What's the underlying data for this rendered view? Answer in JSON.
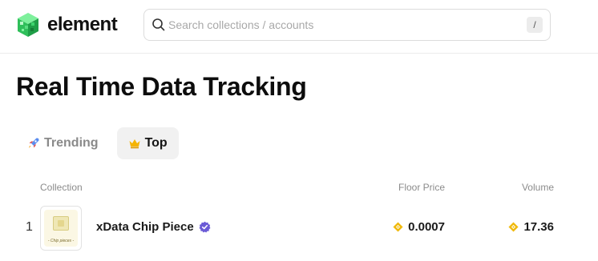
{
  "brand": {
    "name": "element"
  },
  "search": {
    "placeholder": "Search collections / accounts",
    "value": "",
    "shortcut": "/"
  },
  "page": {
    "title": "Real Time Data Tracking"
  },
  "tabs": [
    {
      "label": "Trending",
      "icon": "rocket-icon",
      "active": false
    },
    {
      "label": "Top",
      "icon": "crown-icon",
      "active": true
    }
  ],
  "table": {
    "columns": {
      "collection": "Collection",
      "floor_price": "Floor Price",
      "volume": "Volume"
    },
    "rows": [
      {
        "rank": "1",
        "thumbnail_caption": "- Chip pieces -",
        "name": "xData Chip Piece",
        "verified": true,
        "floor_price": "0.0007",
        "volume": "17.36",
        "currency_icon": "bnb-icon"
      }
    ]
  },
  "colors": {
    "accent": "#1a1a1a",
    "verified": "#6b5bd6",
    "bnb": "#f0b90b",
    "logo_green": "#3ed36d"
  }
}
